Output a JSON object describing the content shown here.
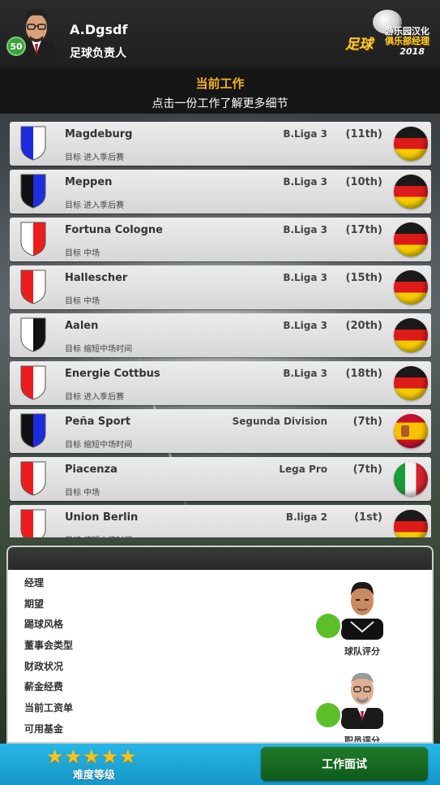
{
  "header": {
    "level": "50",
    "user_name": "A.Dgsdf",
    "user_role": "足球负责人",
    "logo": {
      "line1": "游乐园汉化",
      "line2": "足球",
      "line3": "俱乐部经理",
      "line4": "2018"
    }
  },
  "title": {
    "heading": "当前工作",
    "subheading": "点击一份工作了解更多细节"
  },
  "jobs": [
    {
      "club": "Magdeburg",
      "goal": "目标 进入季后赛",
      "league": "B.Liga 3",
      "rank": "(11th)",
      "flag": "de",
      "crest": [
        "#1a2be0",
        "#ffffff"
      ]
    },
    {
      "club": "Meppen",
      "goal": "目标 进入季后赛",
      "league": "B.Liga 3",
      "rank": "(10th)",
      "flag": "de",
      "crest": [
        "#111111",
        "#1d2fe0"
      ]
    },
    {
      "club": "Fortuna Cologne",
      "goal": "目标 中场",
      "league": "B.Liga 3",
      "rank": "(17th)",
      "flag": "de",
      "crest": [
        "#ffffff",
        "#ee1c1c"
      ]
    },
    {
      "club": "Hallescher",
      "goal": "目标 中场",
      "league": "B.Liga 3",
      "rank": "(15th)",
      "flag": "de",
      "crest": [
        "#ee1c1c",
        "#ffffff"
      ]
    },
    {
      "club": "Aalen",
      "goal": "目标 缩短中场时间",
      "league": "B.Liga 3",
      "rank": "(20th)",
      "flag": "de",
      "crest": [
        "#ffffff",
        "#111111"
      ]
    },
    {
      "club": "Energie Cottbus",
      "goal": "目标 进入季后赛",
      "league": "B.Liga 3",
      "rank": "(18th)",
      "flag": "de",
      "crest": [
        "#ee1c1c",
        "#ffffff"
      ]
    },
    {
      "club": "Peña Sport",
      "goal": "目标 缩短中场时间",
      "league": "Segunda Division",
      "rank": "(7th)",
      "flag": "es",
      "crest": [
        "#111111",
        "#1a2be0"
      ]
    },
    {
      "club": "Piacenza",
      "goal": "目标 中场",
      "league": "Lega Pro",
      "rank": "(7th)",
      "flag": "it",
      "crest": [
        "#ee1c1c",
        "#ffffff"
      ]
    },
    {
      "club": "Union Berlin",
      "goal": "目标 缩短中场时间",
      "league": "B.liga 2",
      "rank": "(1st)",
      "flag": "de",
      "crest": [
        "#ee1c1c",
        "#ffffff"
      ]
    }
  ],
  "details": {
    "rows": [
      "经理",
      "期望",
      "踢球风格",
      "董事会类型",
      "财政状况",
      "薪金经费",
      "当前工资单",
      "可用基金"
    ],
    "team_rating_label": "球队评分",
    "staff_rating_label": "职员评分"
  },
  "bottom": {
    "stars": "★★★★★",
    "star_count": 5,
    "difficulty_label": "难度等级",
    "interview_button": "工作面试"
  },
  "colors": {
    "accent_gold": "#f4b31c",
    "button_green": "#1f7a2a",
    "bottom_blue": "#1fa6d8",
    "rating_green": "#5cbf2a"
  }
}
